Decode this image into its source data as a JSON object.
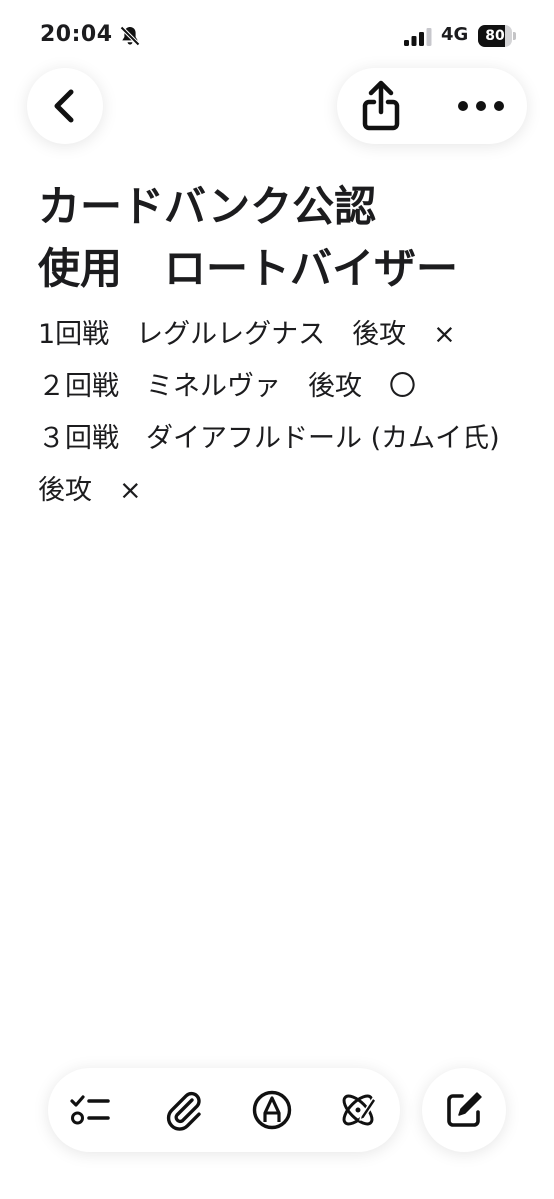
{
  "status_bar": {
    "time": "20:04",
    "network": "4G",
    "battery_level": "80",
    "battery_fraction": 0.8,
    "icons": [
      "bell-slash-icon",
      "signal-bars-icon",
      "battery-icon"
    ]
  },
  "nav": {
    "icons": [
      "chevron-left-icon",
      "share-icon",
      "ellipsis-icon"
    ]
  },
  "note": {
    "title": "カードバンク公認\n使用　ロートバイザー",
    "lines": [
      "1回戦　レグルレグナス　後攻　×",
      "２回戦　ミネルヴァ　後攻　〇",
      "３回戦　ダイアフルドール (カムイ氏) 後攻　×"
    ]
  },
  "toolbar": {
    "icons": [
      "checklist-icon",
      "paperclip-icon",
      "markup-pen-icon",
      "writing-tools-icon",
      "compose-icon"
    ]
  },
  "colors": {
    "text": "#1c1c1e",
    "background": "#ffffff",
    "icon": "#111111"
  }
}
